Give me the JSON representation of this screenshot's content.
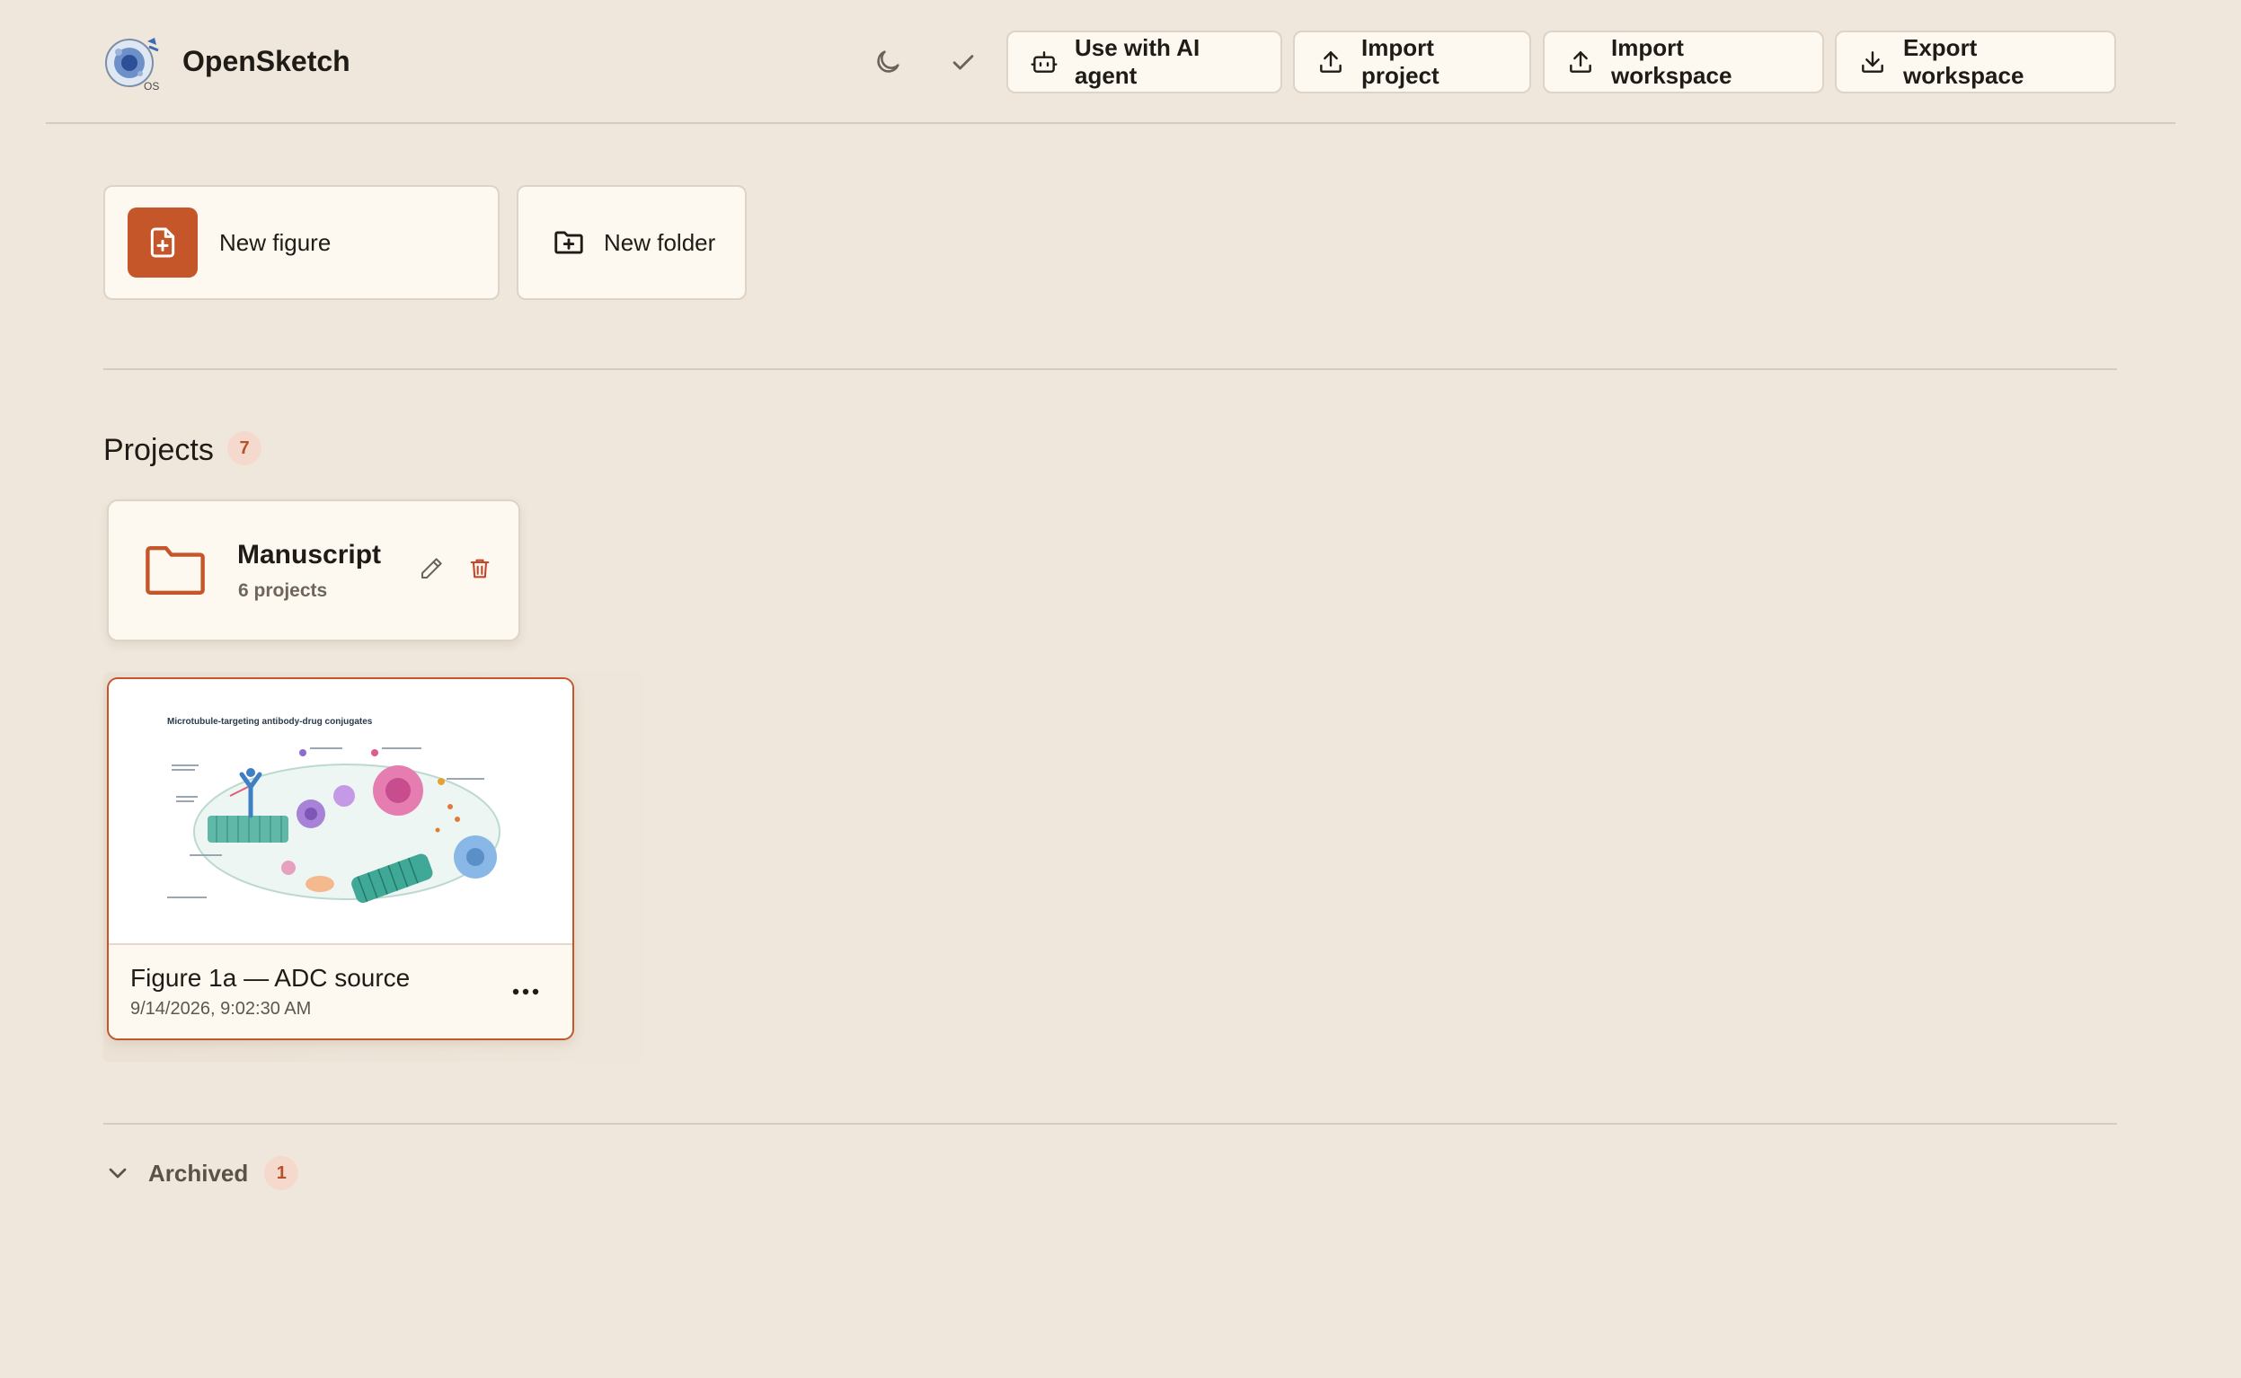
{
  "app": {
    "title": "OpenSketch",
    "logo_text": "OS"
  },
  "header": {
    "buttons": [
      {
        "label": "Use with AI agent",
        "icon": "robot-icon"
      },
      {
        "label": "Import project",
        "icon": "upload-icon"
      },
      {
        "label": "Import workspace",
        "icon": "upload-icon"
      },
      {
        "label": "Export workspace",
        "icon": "download-icon"
      }
    ]
  },
  "create": {
    "new_figure": "New figure",
    "new_folder": "New folder"
  },
  "projects": {
    "title": "Projects",
    "count": "7",
    "folders": [
      {
        "name": "Manuscript",
        "count_label": "6 projects"
      }
    ],
    "items": [
      {
        "name": "Figure 1a — ADC source",
        "date": "9/14/2026, 9:02:30 AM",
        "thumbnail_title": "Microtubule-targeting antibody-drug conjugates"
      }
    ]
  },
  "archived": {
    "label": "Archived",
    "count": "1"
  },
  "colors": {
    "background": "#efe7dc",
    "accent": "#c4562a",
    "card": "#fdf9f1",
    "badge_bg": "#f4d9cc"
  }
}
